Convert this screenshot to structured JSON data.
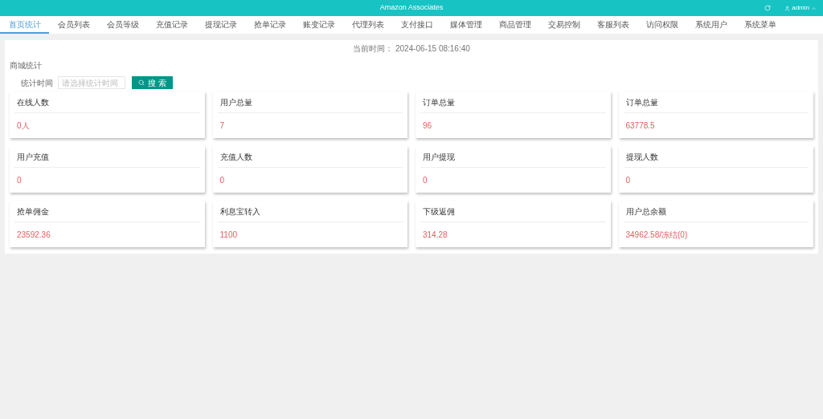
{
  "header": {
    "title": "Amazon Associates",
    "user": "admin"
  },
  "nav": [
    {
      "label": "首页统计",
      "selected": true
    },
    {
      "label": "会员列表",
      "selected": false
    },
    {
      "label": "会员等级",
      "selected": false
    },
    {
      "label": "充值记录",
      "selected": false
    },
    {
      "label": "提现记录",
      "selected": false
    },
    {
      "label": "抢单记录",
      "selected": false
    },
    {
      "label": "账变记录",
      "selected": false
    },
    {
      "label": "代理列表",
      "selected": false
    },
    {
      "label": "支付接口",
      "selected": false
    },
    {
      "label": "媒体管理",
      "selected": false
    },
    {
      "label": "商品管理",
      "selected": false
    },
    {
      "label": "交易控制",
      "selected": false
    },
    {
      "label": "客服列表",
      "selected": false
    },
    {
      "label": "访问权限",
      "selected": false
    },
    {
      "label": "系统用户",
      "selected": false
    },
    {
      "label": "系统菜单",
      "selected": false
    }
  ],
  "current_time": "当前时间： 2024-06-15 08:16:40",
  "section_title": "商城统计",
  "filter": {
    "label": "统计时间",
    "placeholder": "请选择统计时间",
    "button": "搜 索"
  },
  "stats": [
    {
      "title": "在线人数",
      "value": "0人"
    },
    {
      "title": "用户总量",
      "value": "7"
    },
    {
      "title": "订单总量",
      "value": "96"
    },
    {
      "title": "订单总量",
      "value": "63778.5"
    },
    {
      "title": "用户充值",
      "value": "0"
    },
    {
      "title": "充值人数",
      "value": "0"
    },
    {
      "title": "用户提现",
      "value": "0"
    },
    {
      "title": "提现人数",
      "value": "0"
    },
    {
      "title": "抢单佣金",
      "value": "23592.36"
    },
    {
      "title": "利息宝转入",
      "value": "1100"
    },
    {
      "title": "下级返佣",
      "value": "314.28"
    },
    {
      "title": "用户总余额",
      "value": "34962.58/冻结(0)"
    }
  ]
}
